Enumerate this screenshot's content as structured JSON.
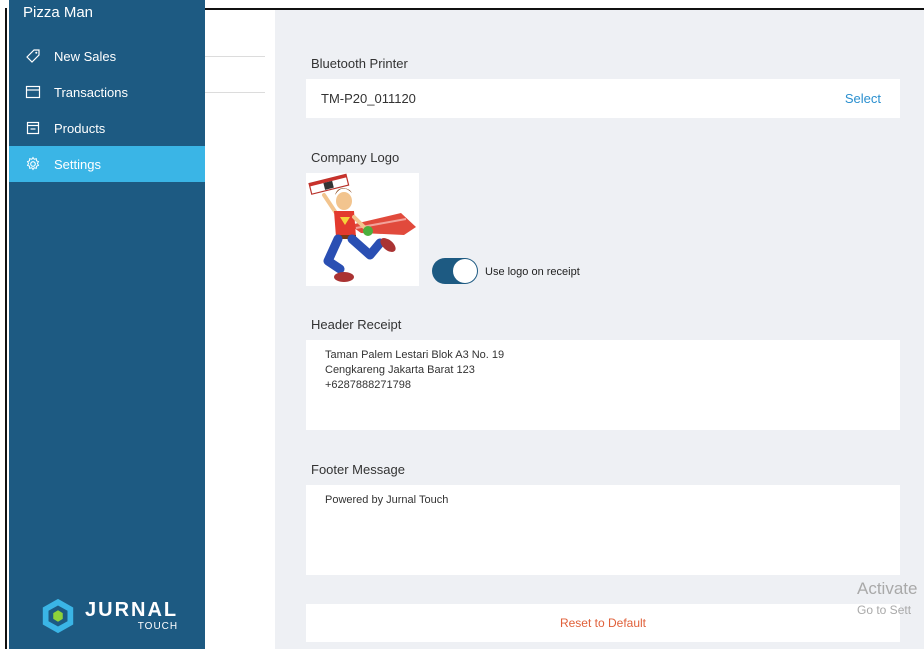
{
  "sidebar": {
    "app_title": "Pizza Man",
    "items": [
      {
        "label": "New Sales",
        "icon": "tag-icon",
        "active": false
      },
      {
        "label": "Transactions",
        "icon": "receipt-list-icon",
        "active": false
      },
      {
        "label": "Products",
        "icon": "box-icon",
        "active": false
      },
      {
        "label": "Settings",
        "icon": "gear-icon",
        "active": true
      }
    ],
    "brand": {
      "name": "JURNAL",
      "sub": "TOUCH"
    }
  },
  "settings": {
    "printer": {
      "label": "Bluetooth Printer",
      "value": "TM-P20_011120",
      "action": "Select"
    },
    "logo": {
      "label": "Company Logo",
      "toggle_label": "Use logo on receipt",
      "toggle_on": true
    },
    "header_receipt": {
      "label": "Header Receipt",
      "text": "Taman Palem Lestari Blok A3 No. 19\nCengkareng Jakarta Barat 123\n+6287888271798"
    },
    "footer_message": {
      "label": "Footer Message",
      "text": "Powered by Jurnal Touch"
    },
    "reset_label": "Reset to Default"
  },
  "watermark": {
    "line1": "Activate",
    "line2": "Go to Sett"
  },
  "colors": {
    "sidebar_bg": "#1d5a82",
    "active_item": "#3ab5e6",
    "link": "#2a8fcf",
    "reset": "#e0603a",
    "content_bg": "#eef0f4"
  }
}
